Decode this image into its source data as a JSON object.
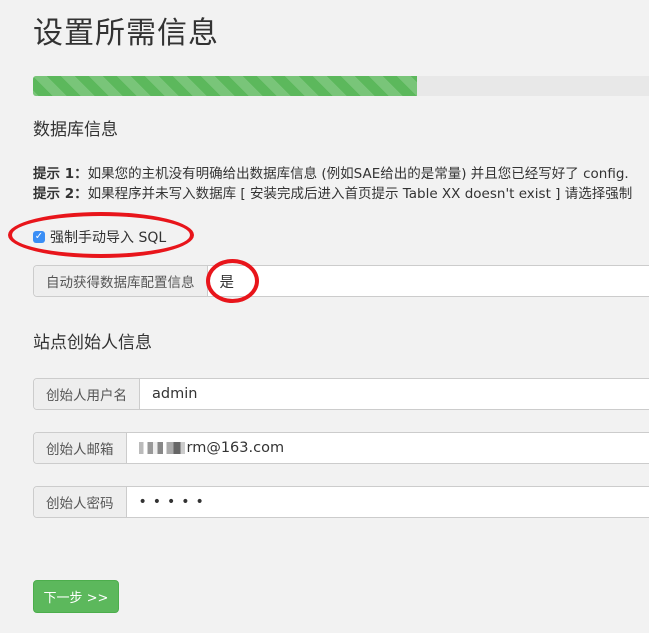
{
  "page": {
    "title": "设置所需信息"
  },
  "progress": {
    "percent": 60
  },
  "database": {
    "section_title": "数据库信息",
    "tip1_label": "提示 1：",
    "tip1_text": "如果您的主机没有明确给出数据库信息 (例如SAE给出的是常量) 并且您已经写好了 config.",
    "tip2_label": "提示 2：",
    "tip2_text": "如果程序并未写入数据库 [ 安装完成后进入首页提示 Table XX doesn't exist ] 请选择强制",
    "force_import_label": "强制手动导入 SQL",
    "force_import_checked": true,
    "auto_config_label": "自动获得数据库配置信息",
    "auto_config_value": "是"
  },
  "founder": {
    "section_title": "站点创始人信息",
    "username_label": "创始人用户名",
    "username_value": "admin",
    "email_label": "创始人邮箱",
    "email_value": "rm@163.com",
    "password_label": "创始人密码",
    "password_value": "•••••"
  },
  "actions": {
    "next_label": "下一步 >>"
  },
  "colors": {
    "progress_fill": "#5cb85c",
    "button_bg": "#5cb85c",
    "checkbox": "#3a8ef5",
    "annotation": "#e8151b"
  }
}
